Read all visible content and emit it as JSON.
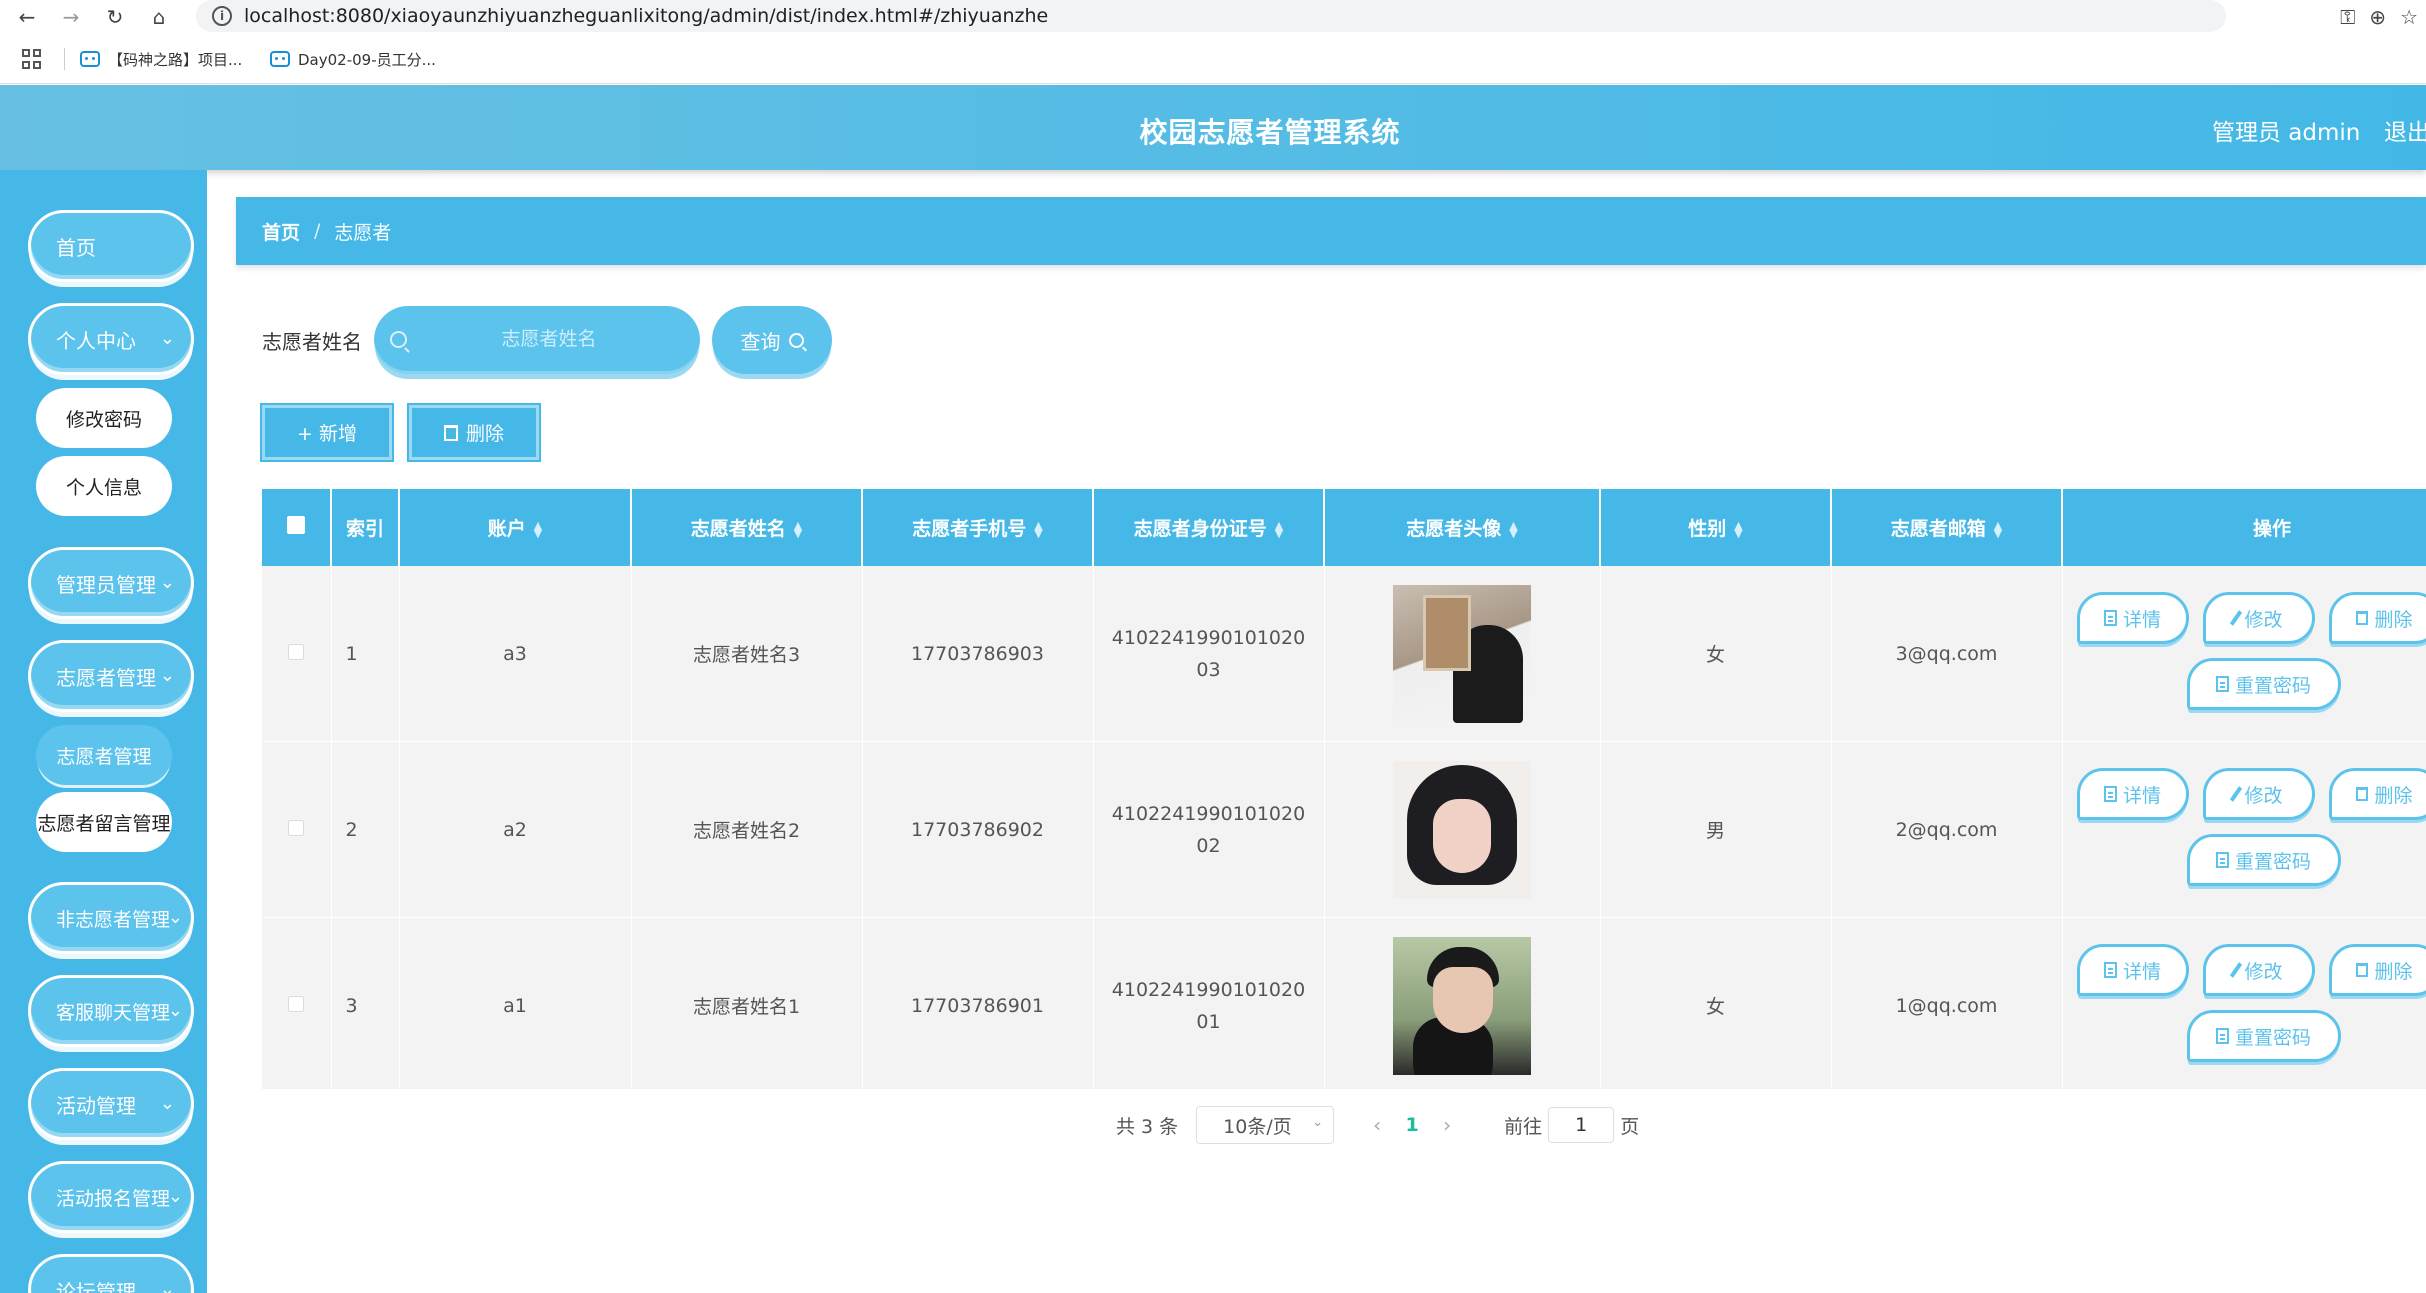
{
  "browser": {
    "url": "localhost:8080/xiaoyaunzhiyuanzheguanlixitong/admin/dist/index.html#/zhiyuanzhe",
    "bookmarks": [
      "【码神之路】项目...",
      "Day02-09-员工分..."
    ]
  },
  "header": {
    "title": "校园志愿者管理系统",
    "admin": "管理员 admin",
    "logout": "退出"
  },
  "sidebar": {
    "items": [
      {
        "label": "首页"
      },
      {
        "label": "个人中心"
      },
      {
        "label": "修改密码"
      },
      {
        "label": "个人信息"
      },
      {
        "label": "管理员管理"
      },
      {
        "label": "志愿者管理"
      },
      {
        "label": "志愿者管理"
      },
      {
        "label": "志愿者留言管理"
      },
      {
        "label": "非志愿者管理"
      },
      {
        "label": "客服聊天管理"
      },
      {
        "label": "活动管理"
      },
      {
        "label": "活动报名管理"
      },
      {
        "label": "论坛管理"
      }
    ]
  },
  "breadcrumb": {
    "home": "首页",
    "sep": "/",
    "current": "志愿者"
  },
  "search": {
    "label": "志愿者姓名",
    "placeholder": "志愿者姓名",
    "button": "查询"
  },
  "actions": {
    "add": "+ 新增",
    "delete": "删除"
  },
  "table": {
    "headers": [
      "索引",
      "账户",
      "志愿者姓名",
      "志愿者手机号",
      "志愿者身份证号",
      "志愿者头像",
      "性别",
      "志愿者邮箱",
      "操作"
    ],
    "rows": [
      {
        "index": "1",
        "account": "a3",
        "name": "志愿者姓名3",
        "phone": "17703786903",
        "idcard": "410224199010102003",
        "gender": "女",
        "email": "3@qq.com"
      },
      {
        "index": "2",
        "account": "a2",
        "name": "志愿者姓名2",
        "phone": "17703786902",
        "idcard": "410224199010102002",
        "gender": "男",
        "email": "2@qq.com"
      },
      {
        "index": "3",
        "account": "a1",
        "name": "志愿者姓名1",
        "phone": "17703786901",
        "idcard": "410224199010102001",
        "gender": "女",
        "email": "1@qq.com"
      }
    ],
    "ops": {
      "detail": "详情",
      "edit": "修改",
      "delete": "删除",
      "reset": "重置密码"
    }
  },
  "pagination": {
    "total": "共 3 条",
    "size": "10条/页",
    "current": "1",
    "goto": "前往",
    "goto_value": "1",
    "page_unit": "页"
  }
}
